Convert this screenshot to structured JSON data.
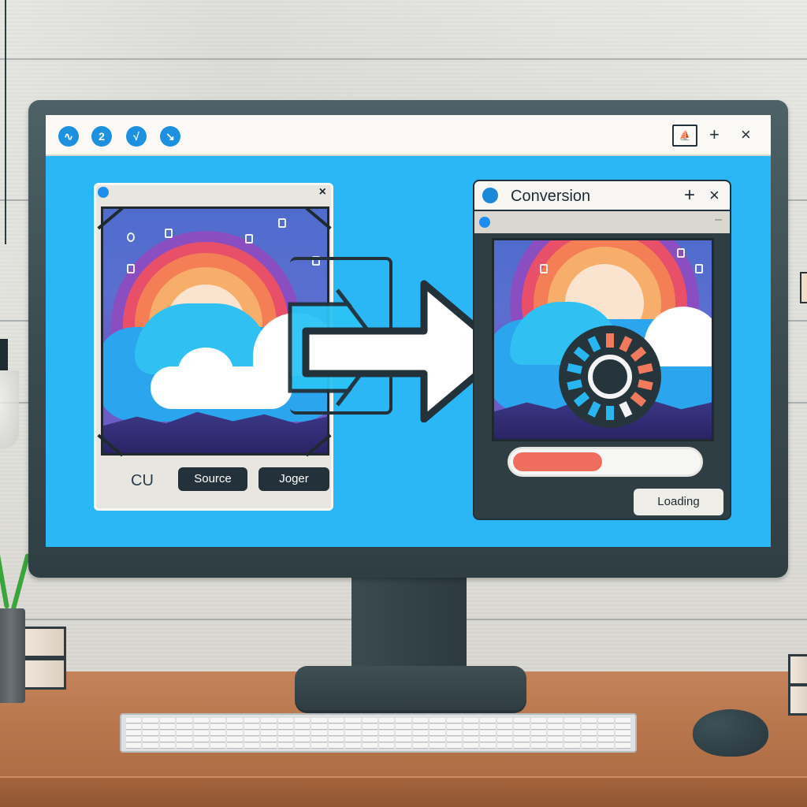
{
  "scene": {
    "description": "Desktop monitor on a wooden desk showing an image conversion app"
  },
  "topbar": {
    "app_icons": [
      {
        "name": "app-icon-1",
        "glyph": "∿"
      },
      {
        "name": "app-icon-2",
        "glyph": "2"
      },
      {
        "name": "app-icon-3",
        "glyph": "√"
      },
      {
        "name": "app-icon-4",
        "glyph": "↘"
      }
    ],
    "window_box_glyph": "⛵",
    "plus_label": "+",
    "close_label": "×"
  },
  "source_window": {
    "close_label": "×",
    "label": "CU",
    "buttons": [
      {
        "label": "Source"
      },
      {
        "label": "Joger"
      }
    ]
  },
  "conversion_window": {
    "title": "Conversion",
    "plus_label": "+",
    "close_label": "×",
    "minimize_label": "–",
    "progress_percent": 48,
    "loading_label": "Loading"
  },
  "colors": {
    "screen_bg": "#2bb6f6",
    "accent_blue": "#1e90e0",
    "progress_fill": "#ee6d5c",
    "spinner_active": "#f07a5e",
    "spinner_inactive": "#29b6f0",
    "bezel": "#3b4c51"
  }
}
